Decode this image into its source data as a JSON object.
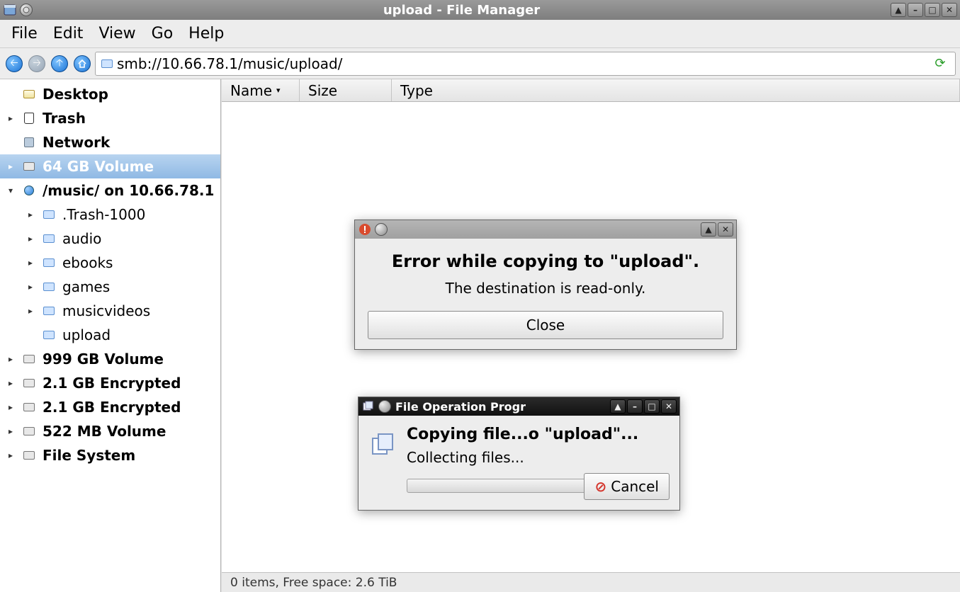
{
  "window": {
    "title": "upload - File Manager"
  },
  "menu": {
    "file": "File",
    "edit": "Edit",
    "view": "View",
    "go": "Go",
    "help": "Help"
  },
  "toolbar": {
    "path": "smb://10.66.78.1/music/upload/"
  },
  "sidebar": {
    "items": [
      {
        "label": "Desktop",
        "icon": "desktop",
        "bold": true,
        "expand": ""
      },
      {
        "label": "Trash",
        "icon": "trash",
        "bold": true,
        "expand": "▸"
      },
      {
        "label": "Network",
        "icon": "network",
        "bold": true,
        "expand": ""
      },
      {
        "label": "64 GB Volume",
        "icon": "drive",
        "bold": true,
        "expand": "▸",
        "selected": true
      },
      {
        "label": "/music/ on 10.66.78.1",
        "icon": "globe",
        "bold": true,
        "expand": "▾"
      },
      {
        "label": ".Trash-1000",
        "icon": "folder",
        "bold": false,
        "expand": "▸",
        "indent": true
      },
      {
        "label": "audio",
        "icon": "folder",
        "bold": false,
        "expand": "▸",
        "indent": true
      },
      {
        "label": "ebooks",
        "icon": "folder",
        "bold": false,
        "expand": "▸",
        "indent": true
      },
      {
        "label": "games",
        "icon": "folder",
        "bold": false,
        "expand": "▸",
        "indent": true
      },
      {
        "label": "musicvideos",
        "icon": "folder",
        "bold": false,
        "expand": "▸",
        "indent": true
      },
      {
        "label": "upload",
        "icon": "folder",
        "bold": false,
        "expand": "",
        "indent": true
      },
      {
        "label": "999 GB Volume",
        "icon": "drive",
        "bold": true,
        "expand": "▸"
      },
      {
        "label": "2.1 GB Encrypted",
        "icon": "drive",
        "bold": true,
        "expand": "▸"
      },
      {
        "label": "2.1 GB Encrypted",
        "icon": "drive",
        "bold": true,
        "expand": "▸"
      },
      {
        "label": "522 MB Volume",
        "icon": "drive",
        "bold": true,
        "expand": "▸"
      },
      {
        "label": "File System",
        "icon": "drive",
        "bold": true,
        "expand": "▸"
      }
    ]
  },
  "columns": {
    "name": "Name",
    "size": "Size",
    "type": "Type"
  },
  "status": "0 items, Free space: 2.6 TiB",
  "error_dialog": {
    "title": "",
    "heading": "Error while copying to \"upload\".",
    "message": "The destination is read-only.",
    "close": "Close"
  },
  "progress_dialog": {
    "title": "File Operation Progr",
    "line1": "Copying file...o \"upload\"...",
    "line2": "Collecting files...",
    "cancel": "Cancel"
  }
}
